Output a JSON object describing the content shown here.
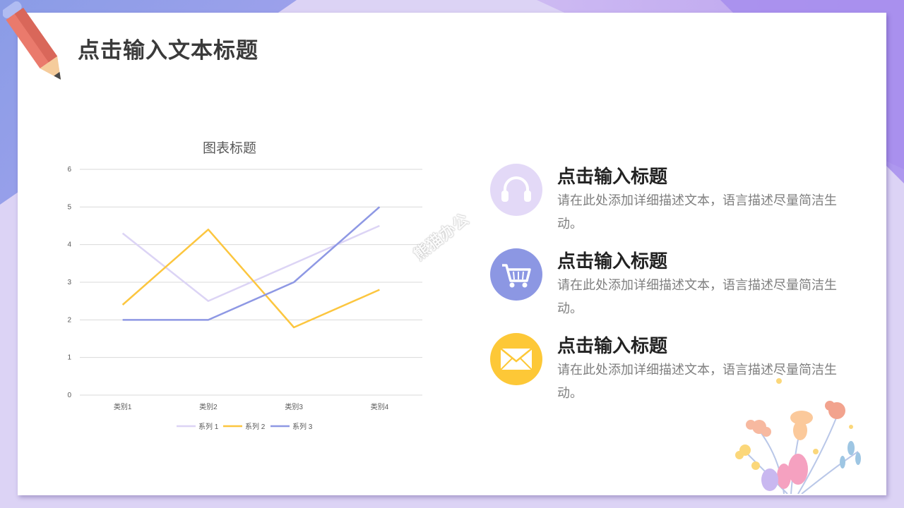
{
  "slide": {
    "title": "点击输入文本标题",
    "watermark": "熊猫办公"
  },
  "features": [
    {
      "title": "点击输入标题",
      "description": "请在此处添加详细描述文本，语言描述尽量简洁生动。",
      "icon": "headphones-icon",
      "color": "#e3d9f7"
    },
    {
      "title": "点击输入标题",
      "description": "请在此处添加详细描述文本，语言描述尽量简洁生动。",
      "icon": "shopping-cart-icon",
      "color": "#8c97e3"
    },
    {
      "title": "点击输入标题",
      "description": "请在此处添加详细描述文本，语言描述尽量简洁生动。",
      "icon": "envelope-icon",
      "color": "#fdc837"
    }
  ],
  "chart_data": {
    "type": "line",
    "title": "图表标题",
    "categories": [
      "类别1",
      "类别2",
      "类别3",
      "类别4"
    ],
    "series": [
      {
        "name": "系列 1",
        "values": [
          4.3,
          2.5,
          3.5,
          4.5
        ],
        "color": "#dcd4f5"
      },
      {
        "name": "系列 2",
        "values": [
          2.4,
          4.4,
          1.8,
          2.8
        ],
        "color": "#fcc63f"
      },
      {
        "name": "系列 3",
        "values": [
          2.0,
          2.0,
          3.0,
          5.0
        ],
        "color": "#8e98e4"
      }
    ],
    "ylim": [
      0,
      6
    ],
    "yticks": [
      "0",
      "1",
      "2",
      "3",
      "4",
      "5",
      "6"
    ],
    "grid": true,
    "legend": "bottom"
  }
}
